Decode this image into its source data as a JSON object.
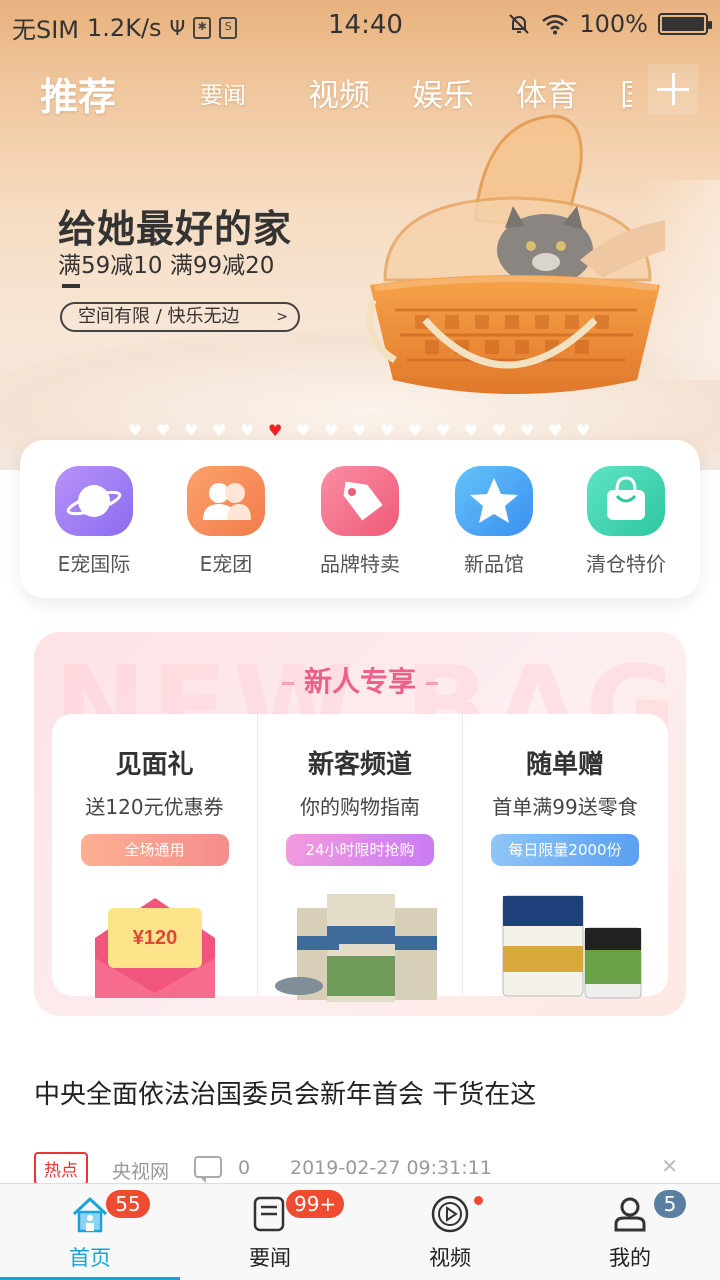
{
  "status_bar": {
    "carrier": "无SIM",
    "speed": "1.2K/s",
    "time": "14:40",
    "battery": "100%"
  },
  "channels": {
    "active": "推荐",
    "items": [
      "要闻",
      "视频",
      "娱乐",
      "体育",
      "国"
    ]
  },
  "banner": {
    "title": "给她最好的家",
    "subtitle": "满59减10 满99减20",
    "button": "空间有限 / 快乐无边",
    "slide_count": 17,
    "active_slide": 5
  },
  "quick_links": [
    {
      "label": "E宠国际",
      "icon": "planet-icon",
      "color": "#9f7df3"
    },
    {
      "label": "E宠团",
      "icon": "group-icon",
      "color": "#f68a5c"
    },
    {
      "label": "品牌特卖",
      "icon": "tag-icon",
      "color": "#f26c86"
    },
    {
      "label": "新品馆",
      "icon": "star-icon",
      "color": "#4aa5f0"
    },
    {
      "label": "清仓特价",
      "icon": "bag-icon",
      "color": "#3ed3b0"
    }
  ],
  "promo": {
    "watermark": "NEW BAG",
    "title": "新人专享",
    "columns": [
      {
        "title": "见面礼",
        "subtitle": "送120元优惠券",
        "tag": "全场通用",
        "coupon": "¥120"
      },
      {
        "title": "新客频道",
        "subtitle": "你的购物指南",
        "tag": "24小时限时抢购"
      },
      {
        "title": "随单赠",
        "subtitle": "首单满99送零食",
        "tag": "每日限量2000份"
      }
    ]
  },
  "news": {
    "title": "中央全面依法治国委员会新年首会 干货在这",
    "tag": "热点",
    "source": "央视网",
    "comments": "0",
    "datetime": "2019-02-27 09:31:11"
  },
  "tabbar": [
    {
      "label": "首页",
      "badge": "55",
      "active": true
    },
    {
      "label": "要闻",
      "badge": "99+"
    },
    {
      "label": "视频",
      "dot": true
    },
    {
      "label": "我的",
      "badge": "5"
    }
  ]
}
